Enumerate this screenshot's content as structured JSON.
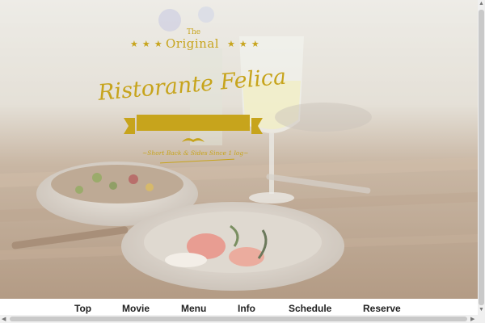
{
  "hero": {
    "brand_the": "The",
    "brand_original": "Original",
    "restaurant_name": "Ristorante Felica",
    "tagline": "~Short Back & Sides Since 1 log~"
  },
  "nav": {
    "items": [
      "Top",
      "Movie",
      "Menu",
      "Info",
      "Schedule",
      "Reserve"
    ]
  },
  "colors": {
    "gold": "#c7a41c",
    "table_wood": "#8b6a4d"
  }
}
